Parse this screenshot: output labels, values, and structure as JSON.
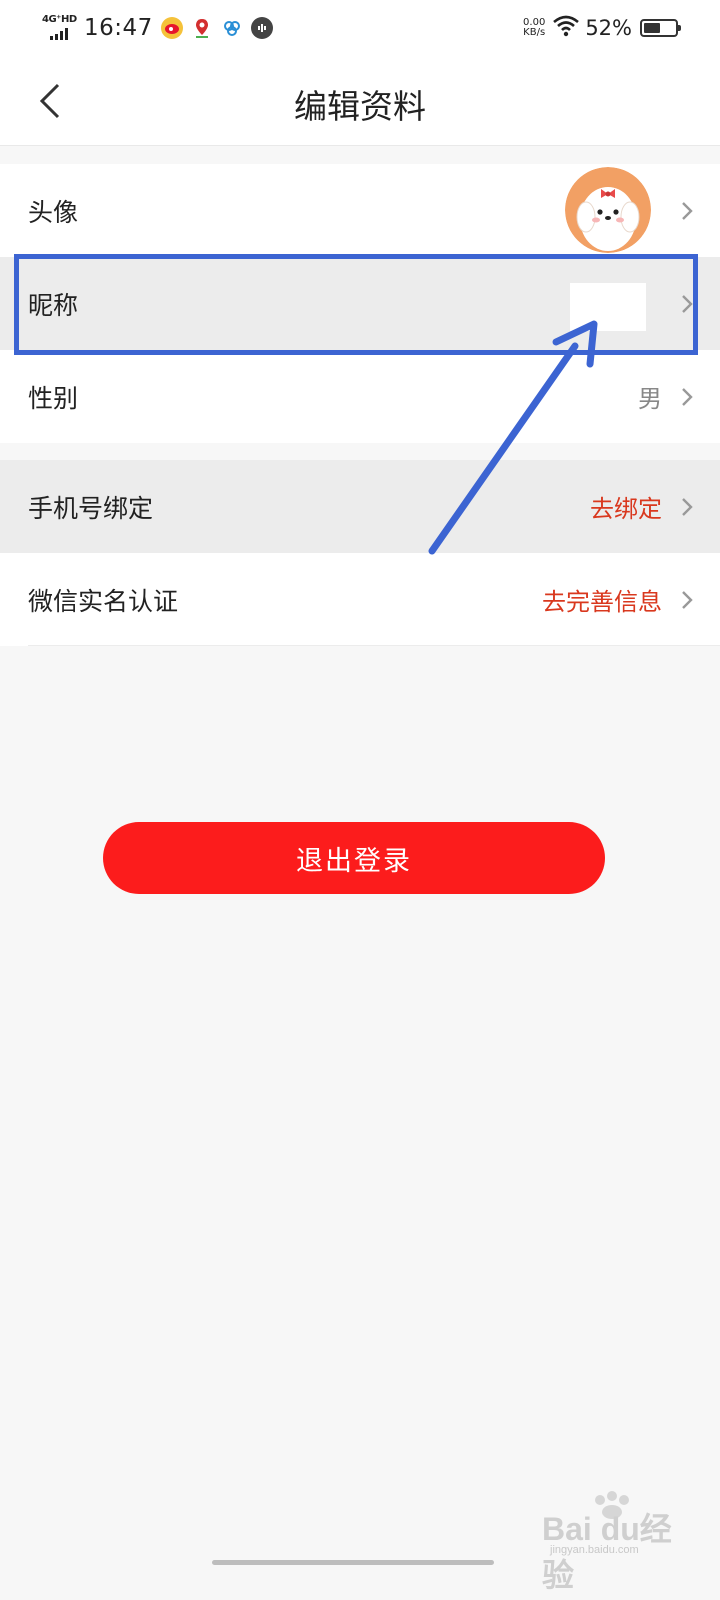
{
  "status_bar": {
    "network": "4G⁺HD",
    "time": "16:47",
    "net_speed_value": "0.00",
    "net_speed_unit": "KB/s",
    "battery_percent": "52%",
    "battery_level": 0.52,
    "icons": [
      "signal-icon",
      "weibo-icon",
      "map-pin-icon",
      "cloud-app-icon",
      "voice-app-icon",
      "wifi-icon",
      "battery-icon"
    ]
  },
  "nav": {
    "title": "编辑资料",
    "back_icon": "chevron-left-icon"
  },
  "profile_rows": [
    {
      "label": "头像",
      "value": "",
      "value_kind": "avatar"
    },
    {
      "label": "昵称",
      "value": "",
      "value_kind": "masked"
    },
    {
      "label": "性别",
      "value": "男",
      "value_kind": "gray"
    }
  ],
  "account_rows": [
    {
      "label": "手机号绑定",
      "value": "去绑定",
      "value_kind": "red"
    },
    {
      "label": "微信实名认证",
      "value": "去完善信息",
      "value_kind": "red"
    }
  ],
  "logout": {
    "label": "退出登录"
  },
  "watermark": {
    "text": "Bai du经验",
    "url": "jingyan.baidu.com"
  },
  "colors": {
    "accent_red": "#fc1c1c",
    "link_red": "#d9381e",
    "annotation_blue": "#3c64d2",
    "row_highlight": "#ececec"
  }
}
